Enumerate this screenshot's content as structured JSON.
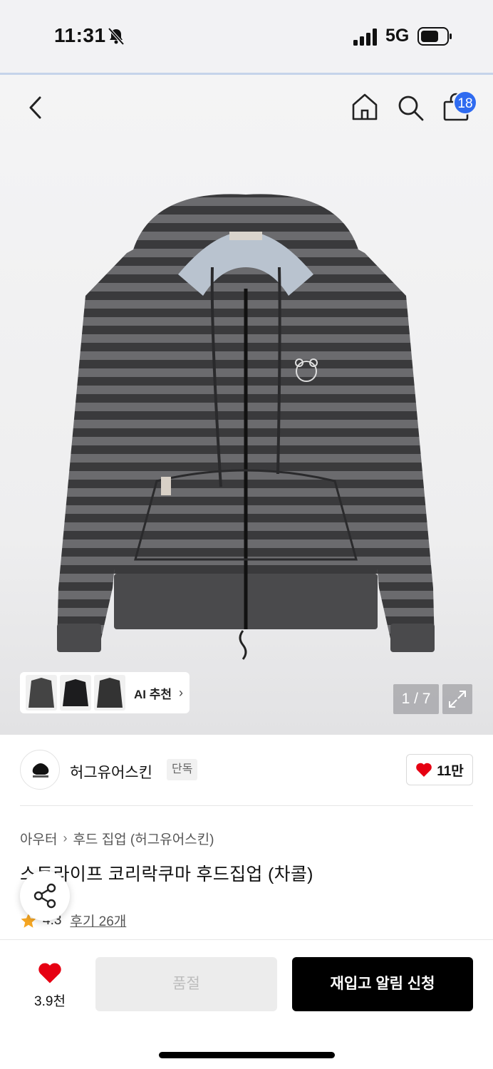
{
  "status_bar": {
    "time": "11:31",
    "network": "5G"
  },
  "header": {
    "cart_count": "18"
  },
  "gallery": {
    "ai_label": "AI 추천",
    "counter": "1 / 7"
  },
  "brand": {
    "name": "허그유어스킨",
    "tag": "단독",
    "likes": "11만",
    "accent_color": "#e60012"
  },
  "breadcrumb": [
    "아우터",
    "후드 집업 (허그유어스킨)"
  ],
  "product": {
    "title": "스트라이프 코리락쿠마 후드집업 (차콜)",
    "rating": "4.3",
    "reviews": "후기 26개"
  },
  "bottom_bar": {
    "wish_count": "3.9천",
    "soldout_label": "품절",
    "restock_label": "재입고 알림 신청"
  },
  "colors": {
    "accent_blue": "#2f6bf0",
    "heart_red": "#e60012",
    "star": "#f5a623"
  }
}
